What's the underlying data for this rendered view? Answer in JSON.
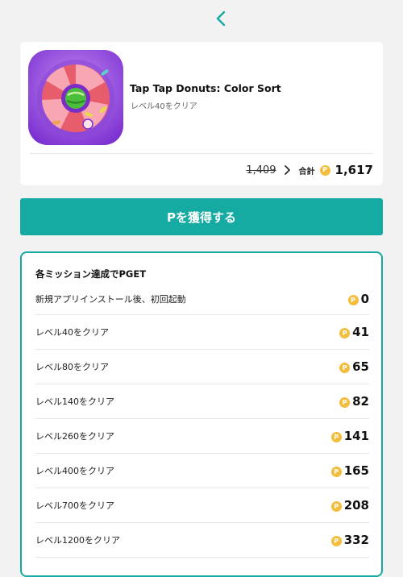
{
  "app": {
    "title": "Tap Tap Donuts: Color Sort",
    "condition": "レベル40をクリア"
  },
  "price": {
    "original": "1,409",
    "total_label": "合計",
    "total": "1,617",
    "coin_symbol": "P"
  },
  "cta": {
    "label": "Pを獲得する"
  },
  "missions": {
    "title": "各ミッション達成でPGET",
    "items": [
      {
        "label": "新規アプリインストール後、初回起動",
        "points": "0"
      },
      {
        "label": "レベル40をクリア",
        "points": "41"
      },
      {
        "label": "レベル80をクリア",
        "points": "65"
      },
      {
        "label": "レベル140をクリア",
        "points": "82"
      },
      {
        "label": "レベル260をクリア",
        "points": "141"
      },
      {
        "label": "レベル400をクリア",
        "points": "165"
      },
      {
        "label": "レベル700をクリア",
        "points": "208"
      },
      {
        "label": "レベル1200をクリア",
        "points": "332"
      }
    ]
  },
  "colors": {
    "accent": "#15aba2",
    "coin": "#f4bd3b",
    "background": "#f2f2f2"
  },
  "icons": {
    "back": "chevron-left-icon",
    "price_arrow": "chevron-right-icon",
    "coin": "p-coin-icon"
  }
}
